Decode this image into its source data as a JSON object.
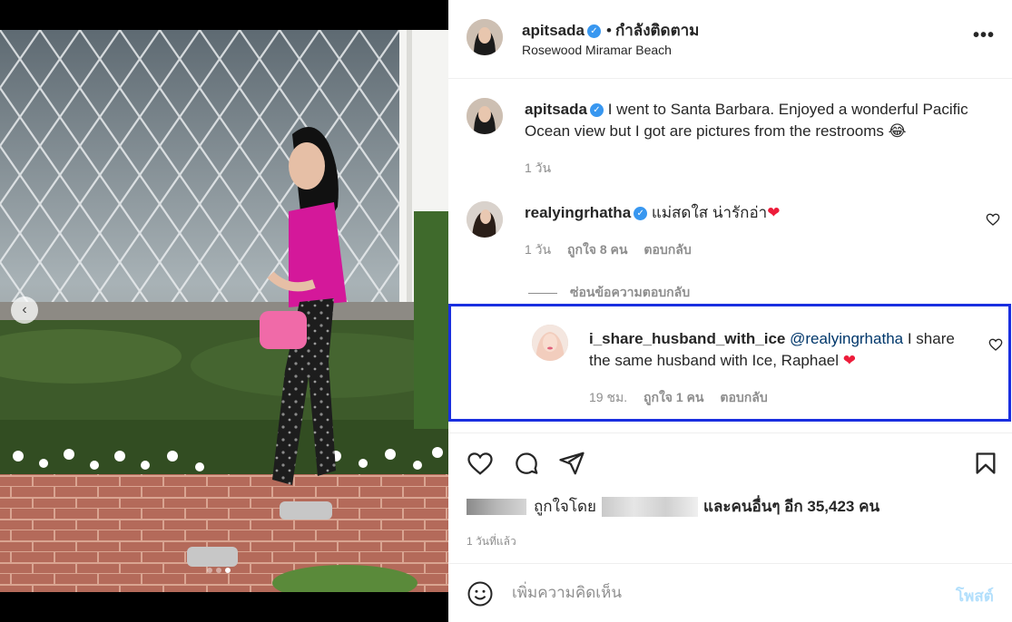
{
  "post": {
    "author": "apitsada",
    "separator": "•",
    "follow_status": "กำลังติดตาม",
    "location": "Rosewood Miramar Beach",
    "more_label": "•••"
  },
  "caption": {
    "username": "apitsada",
    "text": "I went to Santa Barbara. Enjoyed a wonderful Pacific Ocean view but I got are pictures from the restrooms 😂",
    "age": "1 วัน"
  },
  "comments": [
    {
      "username": "realyingrhatha",
      "text": "แม่สดใส น่ารักอ่า",
      "emoji": "❤",
      "age": "1 วัน",
      "likes": "ถูกใจ 8 คน",
      "reply_label": "ตอบกลับ"
    }
  ],
  "hide_replies": "ซ่อนข้อความตอบกลับ",
  "reply": {
    "username": "i_share_husband_with_ice",
    "mention": "@realyingrhatha",
    "text": "I share the same husband with Ice, Raphael",
    "emoji": "❤",
    "age": "19 ชม.",
    "likes": "ถูกใจ 1 คน",
    "reply_label": "ตอบกลับ"
  },
  "likes_summary": {
    "prefix": "ถูกใจโดย",
    "suffix": "และคนอื่นๆ อีก 35,423 คน"
  },
  "time_ago": "1 วันที่แล้ว",
  "comment_box": {
    "placeholder": "เพิ่มความคิดเห็น",
    "post_label": "โพสต์"
  },
  "carousel": {
    "prev_label": "‹",
    "slide_count": 3,
    "active_slide": 3
  },
  "colors": {
    "verified": "#3897f0",
    "highlight_border": "#1a2fe0",
    "heart": "#ed4956",
    "post_disabled": "#b2dffc"
  }
}
